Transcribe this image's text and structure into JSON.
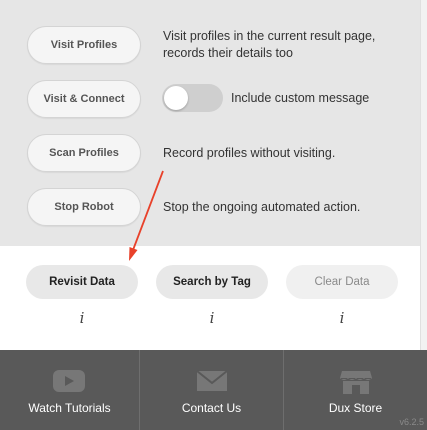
{
  "actions": [
    {
      "label": "Visit Profiles",
      "desc": "Visit profiles in the current result page, records their details too"
    },
    {
      "label": "Visit & Connect",
      "toggle_label": "Include custom message",
      "toggle_on": false
    },
    {
      "label": "Scan Profiles",
      "desc": "Record profiles without visiting."
    },
    {
      "label": "Stop Robot",
      "desc": "Stop the ongoing automated action."
    }
  ],
  "data_buttons": [
    {
      "label": "Revisit Data",
      "info": "i"
    },
    {
      "label": "Search by Tag",
      "info": "i"
    },
    {
      "label": "Clear Data",
      "info": "i",
      "disabled": true
    }
  ],
  "footer": {
    "items": [
      {
        "label": "Watch Tutorials",
        "icon": "youtube-icon"
      },
      {
        "label": "Contact Us",
        "icon": "envelope-icon"
      },
      {
        "label": "Dux Store",
        "icon": "store-icon"
      }
    ],
    "version": "v6.2.5"
  },
  "colors": {
    "panel_bg": "#e6e6e6",
    "footer_bg": "#595959",
    "arrow": "#e8412a"
  }
}
